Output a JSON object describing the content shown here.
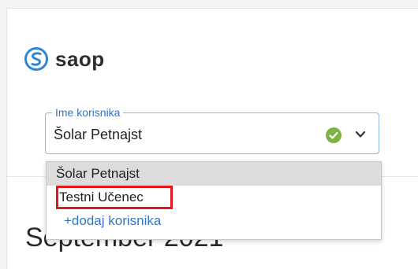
{
  "brand": {
    "name": "saop"
  },
  "user_select": {
    "legend": "Ime korisnika",
    "value": "Šolar Petnajst",
    "status_icon": "check-circle-icon",
    "status_color": "#7cb342",
    "expand_icon": "chevron-down-icon"
  },
  "dropdown": {
    "options": [
      "Šolar Petnajst",
      "Testni Učenec"
    ],
    "add_user": "+dodaj korisnika"
  },
  "calendar": {
    "month_title": "September 2021"
  },
  "colors": {
    "accent": "#2f76c9",
    "highlight": "#e2161b"
  }
}
